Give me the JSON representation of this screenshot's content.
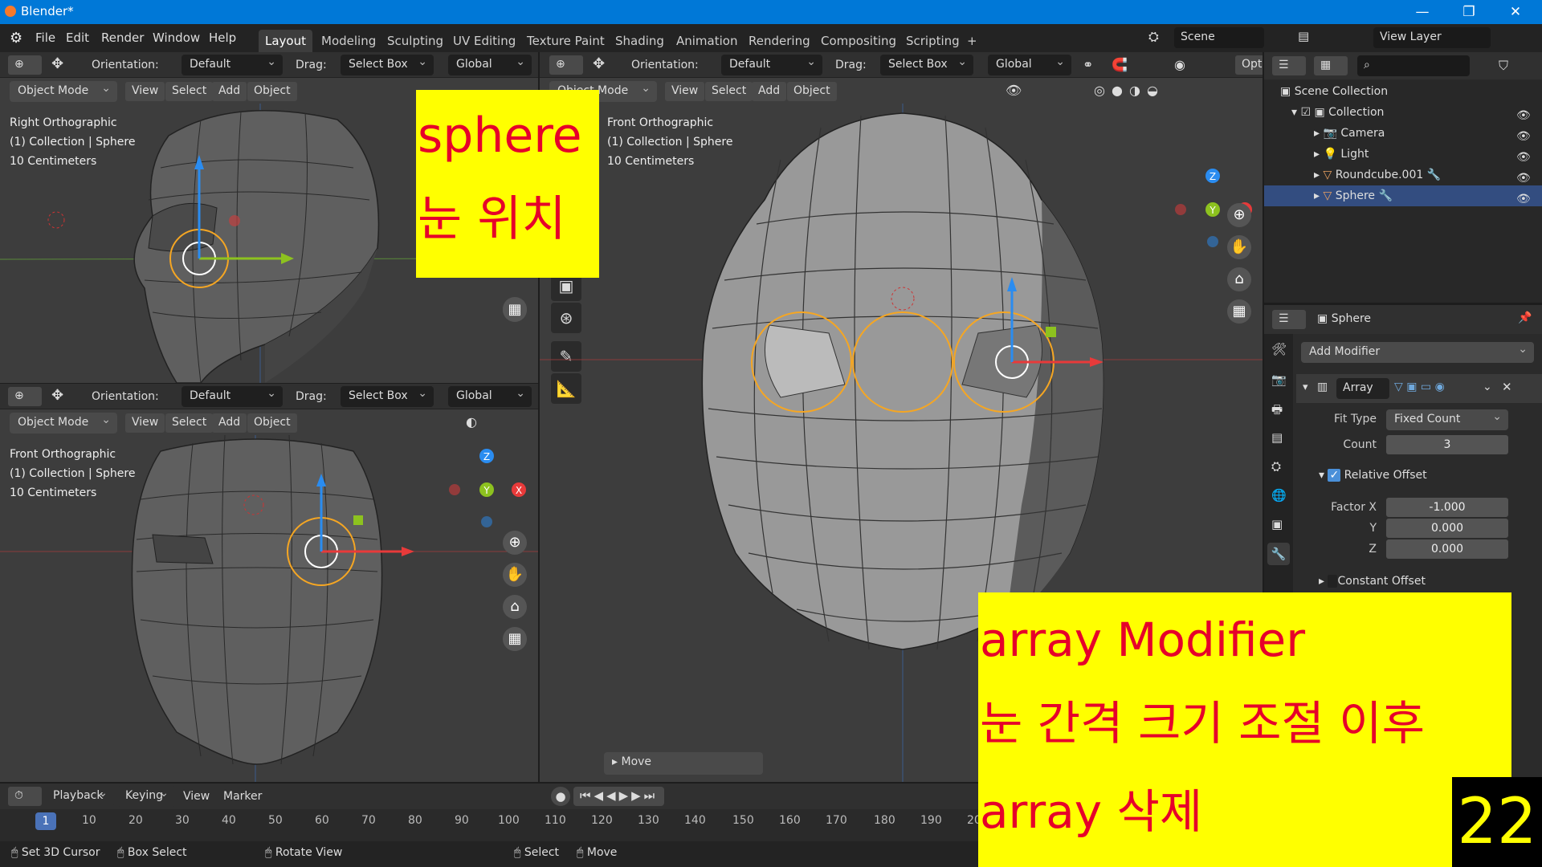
{
  "window": {
    "title": "Blender*"
  },
  "menu": [
    "File",
    "Edit",
    "Render",
    "Window",
    "Help"
  ],
  "workspaces": [
    "Layout",
    "Modeling",
    "Sculpting",
    "UV Editing",
    "Texture Paint",
    "Shading",
    "Animation",
    "Rendering",
    "Compositing",
    "Scripting"
  ],
  "scene": "Scene",
  "view_layer": "View Layer",
  "header": {
    "orientation_label": "Orientation:",
    "orientation": "Default",
    "drag_label": "Drag:",
    "drag": "Select Box",
    "transform": "Global",
    "opt": "Opt"
  },
  "viewport_menu": {
    "mode": "Object Mode",
    "view": "View",
    "select": "Select",
    "add": "Add",
    "object": "Object"
  },
  "vp_tl": {
    "name": "Right Orthographic",
    "coll": "(1) Collection | Sphere",
    "scale": "10 Centimeters"
  },
  "vp_bl": {
    "name": "Front Orthographic",
    "coll": "(1) Collection | Sphere",
    "scale": "10 Centimeters"
  },
  "vp_main": {
    "name": "Front Orthographic",
    "coll": "(1) Collection | Sphere",
    "scale": "10 Centimeters",
    "last_op": "Move"
  },
  "gizmo_axes": {
    "x": "X",
    "y": "Y",
    "z": "Z"
  },
  "outliner": {
    "root": "Scene Collection",
    "items": [
      "Collection",
      "Camera",
      "Light",
      "Roundcube.001",
      "Sphere"
    ]
  },
  "properties": {
    "object": "Sphere",
    "add_modifier": "Add Modifier",
    "modifier": "Array",
    "fit_type_label": "Fit Type",
    "fit_type": "Fixed Count",
    "count_label": "Count",
    "count": "3",
    "relative_offset": "Relative Offset",
    "factor_x_label": "Factor X",
    "factor_x": "-1.000",
    "y_label": "Y",
    "y": "0.000",
    "z_label": "Z",
    "z": "0.000",
    "constant_offset": "Constant Offset"
  },
  "timeline": {
    "playback": "Playback",
    "keying": "Keying",
    "view": "View",
    "marker": "Marker",
    "current_frame": "1",
    "ticks": [
      "10",
      "20",
      "30",
      "40",
      "50",
      "60",
      "70",
      "80",
      "90",
      "100",
      "110",
      "120",
      "130",
      "140",
      "150",
      "160",
      "170",
      "180",
      "190",
      "20"
    ]
  },
  "statusbar": {
    "a": "Set 3D Cursor",
    "b": "Box Select",
    "c": "Rotate View",
    "d": "Select",
    "e": "Move"
  },
  "notes": {
    "top_line1": "sphere",
    "top_line2": "눈 위치",
    "bottom_line1": "array Modifier",
    "bottom_line2": "눈 간격 크기 조절 이후",
    "bottom_line3": "array 삭제",
    "badge": "22"
  },
  "colors": {
    "accent": "#0078d7",
    "note_bg": "#ffff00",
    "note_text": "#e6002a",
    "selection": "#f5a623",
    "x_axis": "#e83a3a",
    "y_axis": "#8dc21f",
    "z_axis": "#2a8cf0"
  }
}
